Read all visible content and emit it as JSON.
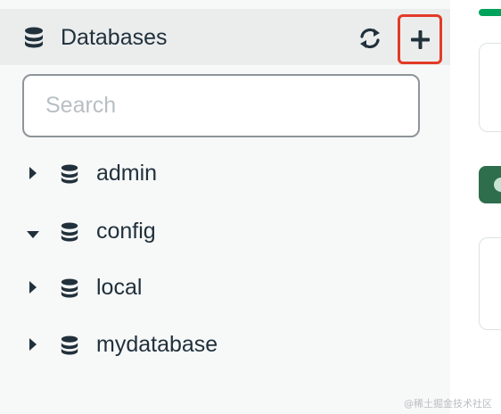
{
  "sidebar": {
    "header": {
      "title": "Databases"
    },
    "search": {
      "placeholder": "Search",
      "value": ""
    },
    "databases": [
      {
        "label": "admin",
        "expanded": false
      },
      {
        "label": "config",
        "expanded": true
      },
      {
        "label": "local",
        "expanded": false
      },
      {
        "label": "mydatabase",
        "expanded": false
      }
    ]
  },
  "watermark": "@稀土掘金技术社区",
  "colors": {
    "accent_highlight": "#e23b27",
    "icon_dark": "#21313c",
    "green": "#00a35c",
    "dark_green": "#2e6e4d"
  },
  "icons": {
    "database": "database-icon",
    "refresh": "refresh-icon",
    "add": "plus-icon",
    "caret_right": "caret-right-icon",
    "caret_down": "caret-down-icon"
  }
}
